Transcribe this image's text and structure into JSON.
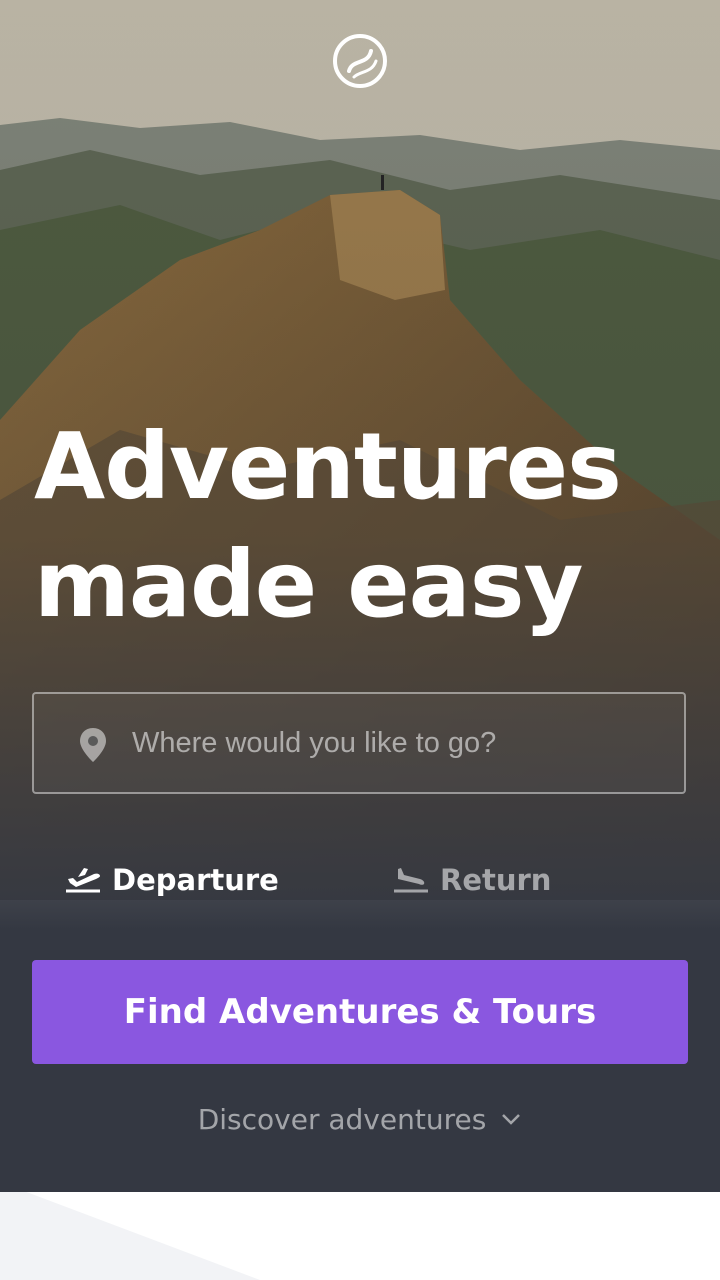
{
  "hero": {
    "headline_line1": "Adventures",
    "headline_line2": "made easy",
    "logo_icon": "coffee-bean-logo-icon"
  },
  "search": {
    "placeholder": "Where would you like to go?",
    "value": "",
    "icon": "map-pin-icon"
  },
  "dates": {
    "departure_label": "Departure",
    "departure_icon": "plane-takeoff-icon",
    "return_label": "Return",
    "return_icon": "plane-landing-icon"
  },
  "cta": {
    "label": "Find Adventures & Tours"
  },
  "discover": {
    "label": "Discover adventures",
    "icon": "chevron-down-icon"
  },
  "colors": {
    "accent": "#8a57e0",
    "overlay": "#343842",
    "text": "#ffffff"
  }
}
